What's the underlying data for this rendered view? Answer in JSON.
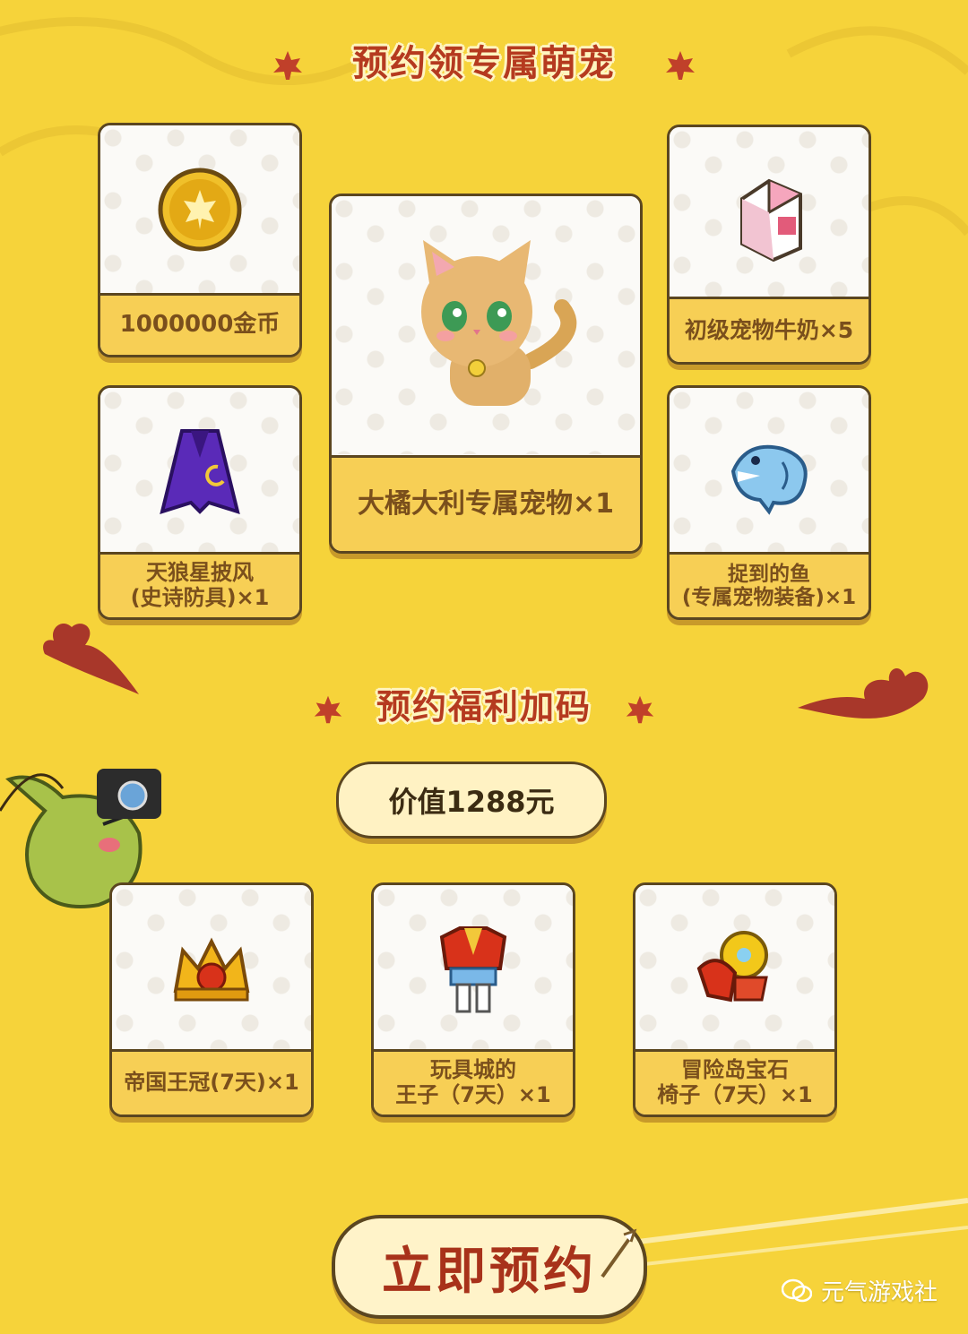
{
  "section1": {
    "title": "预约领专属萌宠"
  },
  "rewards_main": [
    {
      "label": "1000000金币"
    },
    {
      "label": "初级宠物牛奶×5"
    },
    {
      "label": "大橘大利专属宠物×1"
    },
    {
      "label_line1": "天狼星披风",
      "label_line2": "(史诗防具)×1"
    },
    {
      "label_line1": "捉到的鱼",
      "label_line2": "(专属宠物装备)×1"
    }
  ],
  "section2": {
    "title": "预约福利加码",
    "value_text": "价值1288元"
  },
  "rewards_bonus": [
    {
      "label_line1": "帝国王冠(7天)×1",
      "label_line2": ""
    },
    {
      "label_line1": "玩具城的",
      "label_line2": "王子（7天）×1"
    },
    {
      "label_line1": "冒险岛宝石",
      "label_line2": "椅子（7天）×1"
    }
  ],
  "cta": {
    "label": "立即预约"
  },
  "watermark": {
    "text": "元气游戏社"
  },
  "colors": {
    "background": "#f6d33a",
    "title": "#b53a1f",
    "label_bg": "#f7cf55",
    "border": "#5b4620"
  },
  "icons": [
    "maple-leaf-icon",
    "gold-coin-icon",
    "milk-carton-icon",
    "cat-pet-icon",
    "cape-icon",
    "fish-icon",
    "crown-icon",
    "prince-outfit-icon",
    "gem-chair-icon",
    "slime-mascot-icon",
    "camera-icon",
    "wechat-icon",
    "arrow-icon"
  ]
}
